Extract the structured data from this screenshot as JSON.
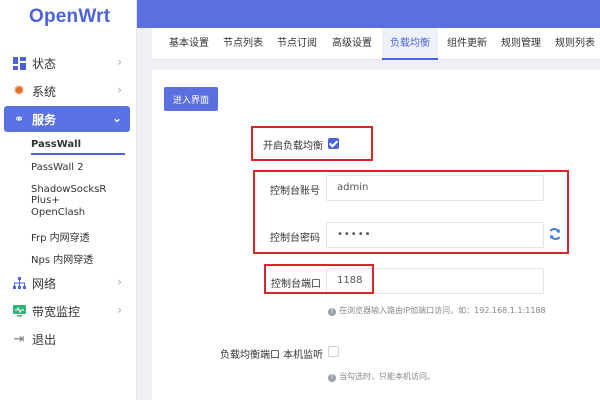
{
  "sidebar": {
    "logo": "OpenWrt",
    "items": [
      {
        "label": "状态",
        "icon": "dashboard-icon"
      },
      {
        "label": "系统",
        "icon": "gear-icon"
      },
      {
        "label": "服务",
        "icon": "link-icon"
      },
      {
        "label": "网络",
        "icon": "network-icon"
      },
      {
        "label": "带宽监控",
        "icon": "monitor-icon"
      },
      {
        "label": "退出",
        "icon": "logout-icon"
      }
    ],
    "subitems": [
      "PassWall",
      "PassWall 2",
      "ShadowSocksR Plus+",
      "OpenClash",
      "Frp 内网穿透",
      "Nps 内网穿透"
    ]
  },
  "tabs": [
    "基本设置",
    "节点列表",
    "节点订阅",
    "高级设置",
    "负载均衡",
    "组件更新",
    "规则管理",
    "规则列表"
  ],
  "active_tab": "负载均衡",
  "form": {
    "enter_button": "进入界面",
    "enable_label": "开启负载均衡",
    "account_label": "控制台账号",
    "account_value": "admin",
    "password_label": "控制台密码",
    "password_value": "•••••",
    "port_label": "控制台端口",
    "port_value": "1188",
    "port_hint": "在浏览器输入路由IP加端口访问，如：192.168.1.1:1188",
    "listen_label": "负载均衡端口 本机监听",
    "listen_hint": "当勾选时，只能本机访问。"
  },
  "colors": {
    "accent": "#5a6fe0",
    "highlight_box": "#d9262b"
  }
}
